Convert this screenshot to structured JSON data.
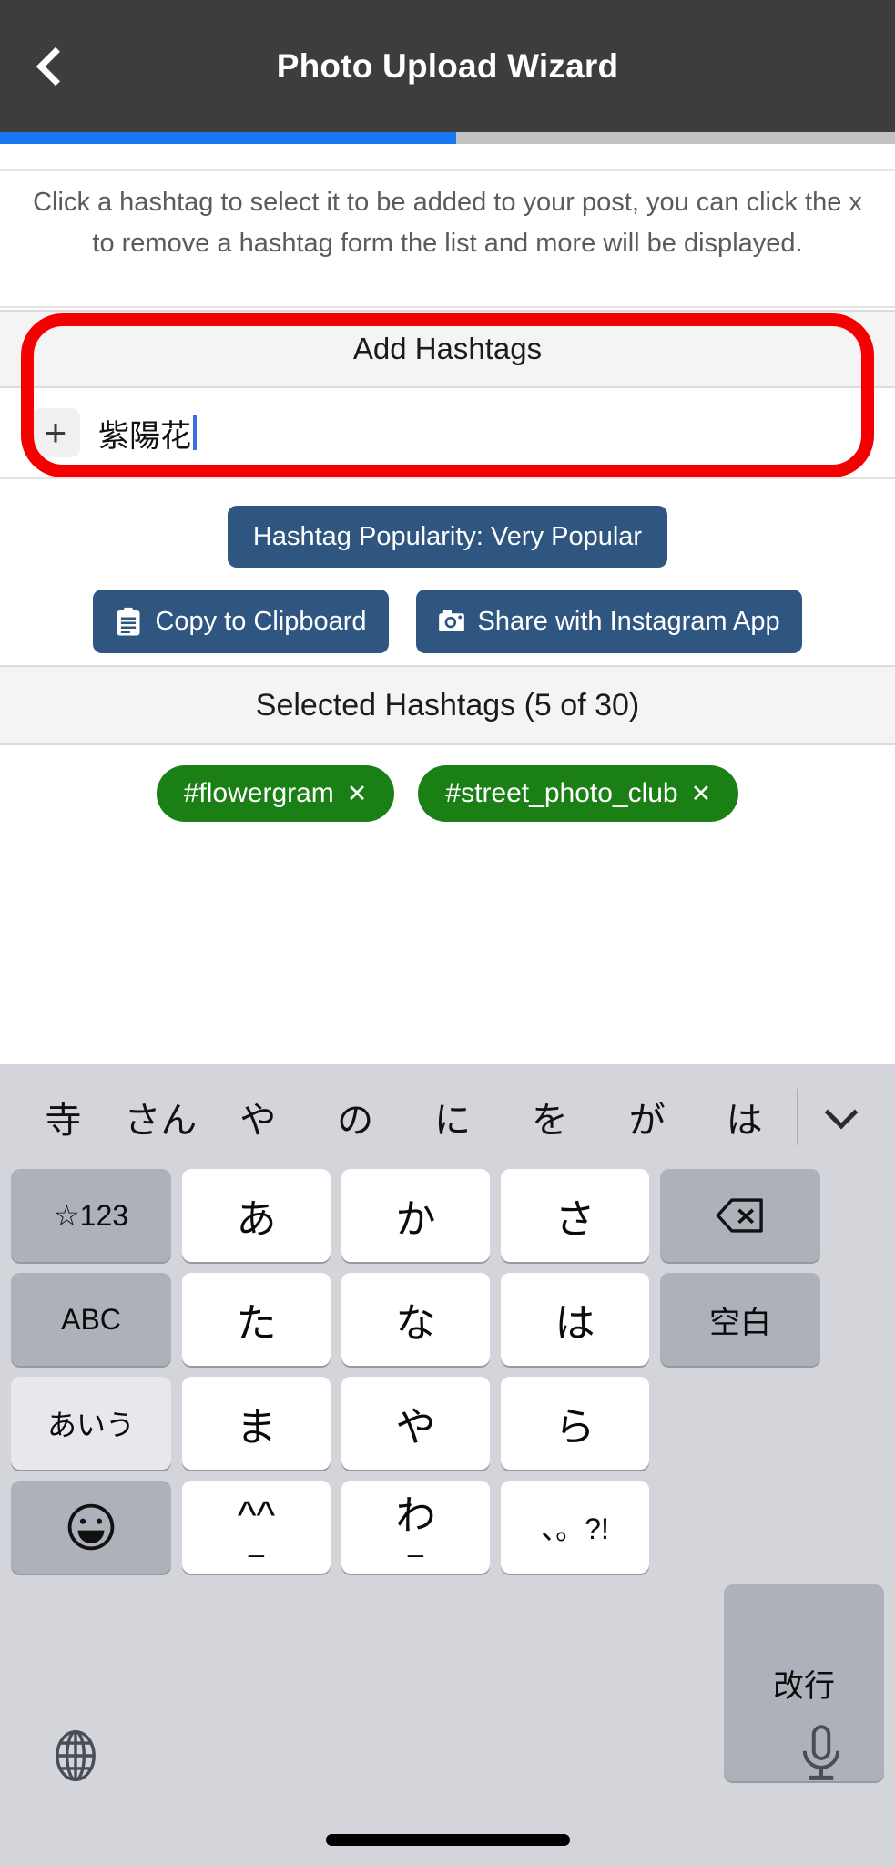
{
  "header": {
    "title": "Photo Upload Wizard",
    "back_icon": "chevron-left-icon",
    "background": "#3d3d3d"
  },
  "progress": {
    "percent": 51,
    "fill_color": "#1877f2",
    "track_color": "#c2c2c2"
  },
  "instruction": {
    "text": "Click a hashtag to select it to be added to your post, you can click the x to remove a hashtag form the list and more will be displayed."
  },
  "add_hashtags": {
    "title": "Add Hashtags",
    "plus_label": "+",
    "input_value": "紫陽花",
    "input_placeholder": "",
    "highlight_color": "#f40000"
  },
  "popularity": {
    "label": "Hashtag Popularity: Very Popular",
    "color": "#2f5680"
  },
  "actions": [
    {
      "label": "Copy to Clipboard",
      "icon": "clipboard-icon"
    },
    {
      "label": "Share with Instagram App",
      "icon": "camera-icon"
    }
  ],
  "selected": {
    "title": "Selected Hashtags (5 of 30)",
    "count": 5,
    "max": 30,
    "chip_color": "#1a8016",
    "chips": [
      {
        "label": "#flowergram",
        "remove": "✕"
      },
      {
        "label": "#street_photo_club",
        "remove": "✕"
      }
    ]
  },
  "keyboard": {
    "suggestions": [
      "寺",
      "さん",
      "や",
      "の",
      "に",
      "を",
      "が",
      "は"
    ],
    "collapse_icon": "chevron-down-icon",
    "rows": [
      [
        {
          "label": "☆123",
          "style": "gray",
          "name": "key-symbols"
        },
        {
          "label": "あ",
          "style": "white",
          "name": "key-a"
        },
        {
          "label": "か",
          "style": "white",
          "name": "key-ka"
        },
        {
          "label": "さ",
          "style": "white",
          "name": "key-sa"
        },
        {
          "label": "",
          "style": "gray",
          "name": "key-delete",
          "icon": "backspace-icon"
        }
      ],
      [
        {
          "label": "ABC",
          "style": "gray",
          "name": "key-abc"
        },
        {
          "label": "た",
          "style": "white",
          "name": "key-ta"
        },
        {
          "label": "な",
          "style": "white",
          "name": "key-na"
        },
        {
          "label": "は",
          "style": "white",
          "name": "key-ha"
        },
        {
          "label": "空白",
          "style": "gray",
          "name": "key-space"
        }
      ],
      [
        {
          "label": "あいう",
          "style": "light",
          "name": "key-kana"
        },
        {
          "label": "ま",
          "style": "white",
          "name": "key-ma"
        },
        {
          "label": "や",
          "style": "white",
          "name": "key-ya"
        },
        {
          "label": "ら",
          "style": "white",
          "name": "key-ra"
        }
      ],
      [
        {
          "label": "",
          "style": "gray",
          "name": "key-emoji",
          "icon": "emoji-icon"
        },
        {
          "label": "^^",
          "sub": "_",
          "style": "white",
          "name": "key-kaomoji"
        },
        {
          "label": "わ",
          "sub": "_",
          "style": "white",
          "name": "key-wa"
        },
        {
          "label": "、。?!",
          "style": "white",
          "name": "key-punctuation"
        }
      ]
    ],
    "return_key": "改行",
    "globe_icon": "globe-icon",
    "mic_icon": "microphone-icon"
  }
}
